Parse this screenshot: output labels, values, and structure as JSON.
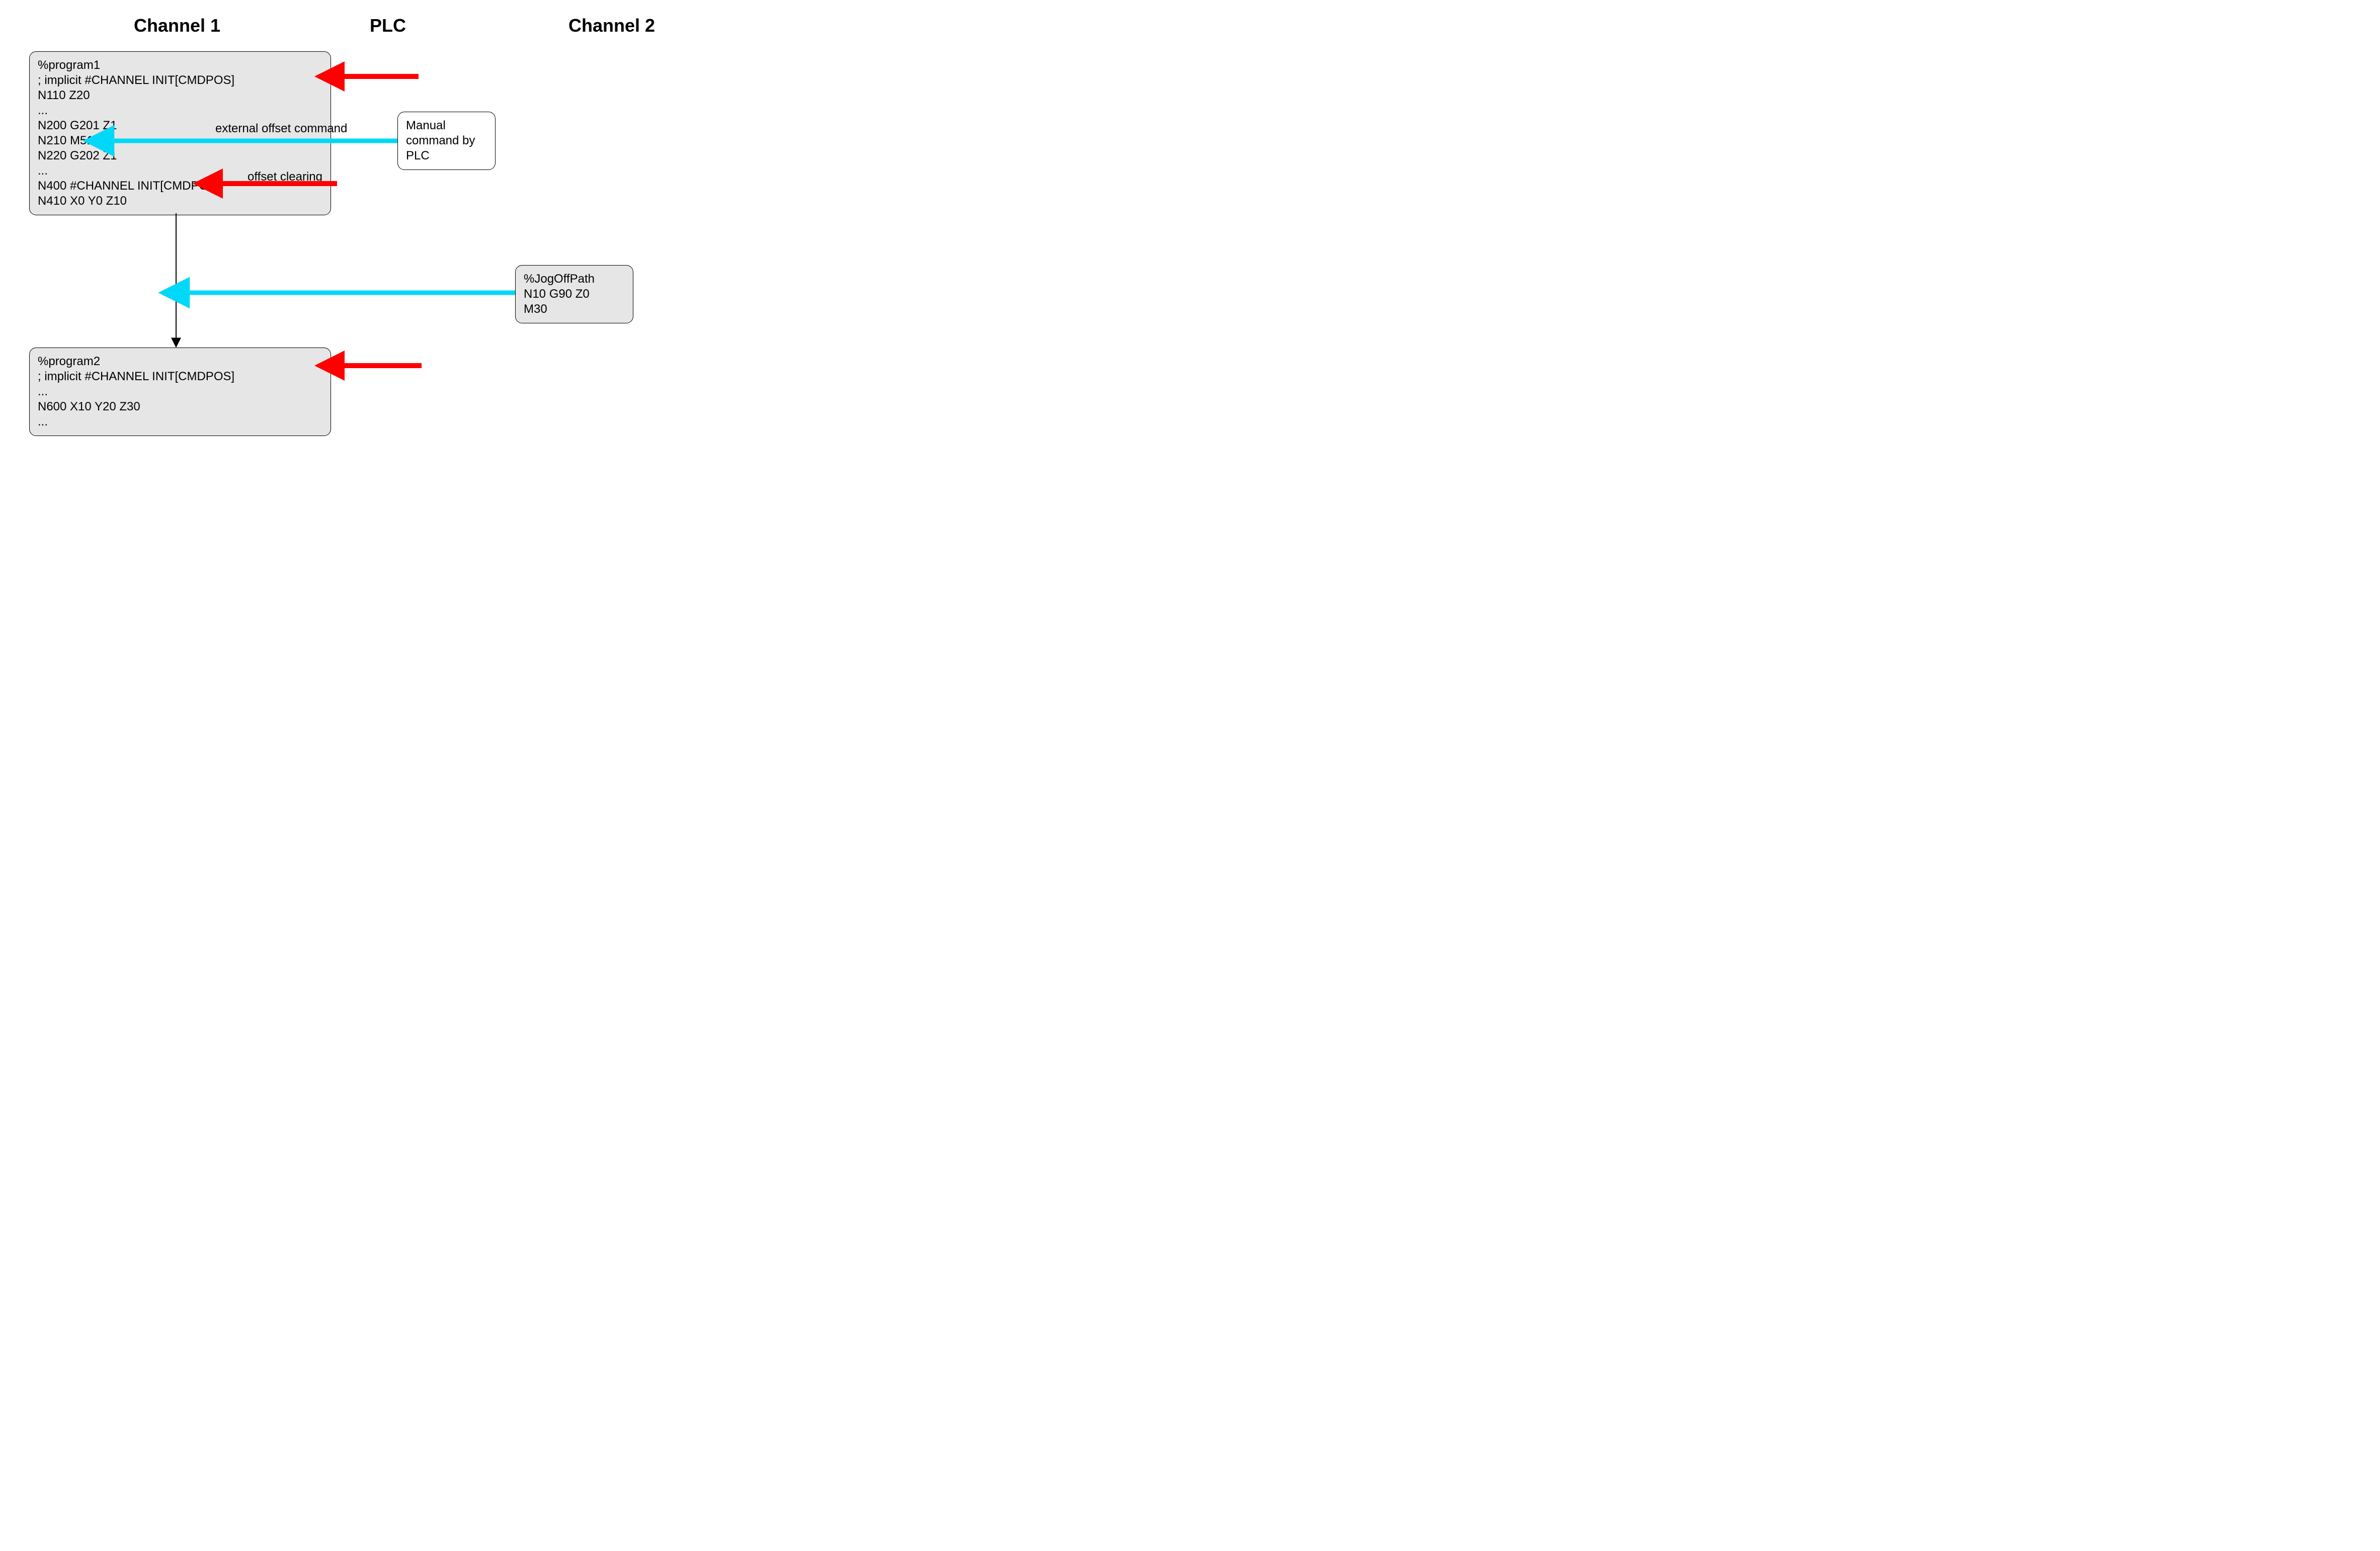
{
  "headings": {
    "channel1": "Channel 1",
    "plc": "PLC",
    "channel2": "Channel 2"
  },
  "boxes": {
    "program1": "%program1\n; implicit #CHANNEL INIT[CMDPOS]\nN110 Z20\n...\nN200 G201 Z1\nN210 M51\nN220 G202 Z1\n...\nN400 #CHANNEL INIT[CMDPOS]\nN410 X0 Y0 Z10",
    "manualCmd": "Manual\ncommand by\nPLC",
    "jogOffPath": "%JogOffPath\nN10 G90 Z0\nM30",
    "program2": "%program2\n; implicit #CHANNEL INIT[CMDPOS]\n...\nN600 X10 Y20 Z30\n..."
  },
  "labels": {
    "externalOffsetCommand": "external offset command",
    "offsetClearing": "offset clearing"
  }
}
